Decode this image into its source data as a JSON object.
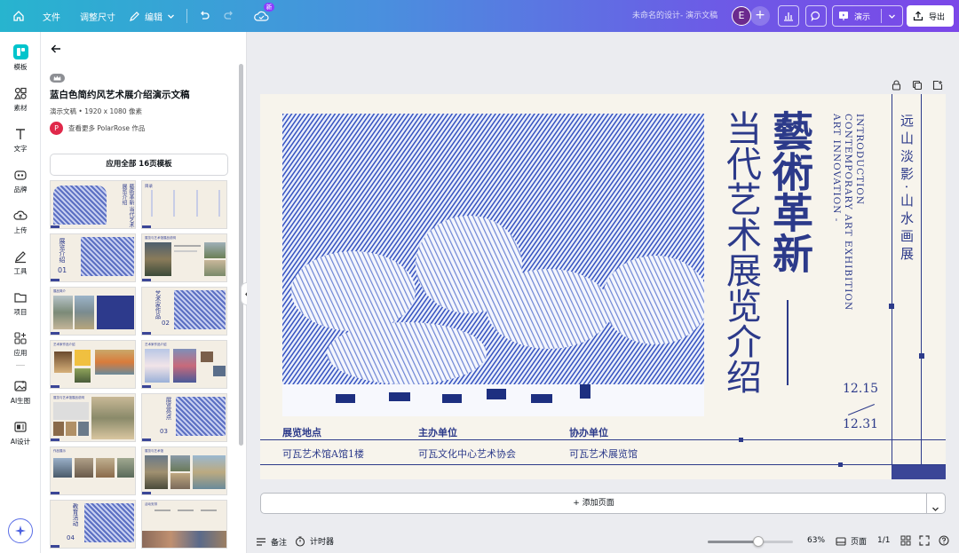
{
  "topbar": {
    "file": "文件",
    "resize": "调整尺寸",
    "edit": "编辑",
    "new_badge": "新",
    "design_title": "未命名的设计- 演示文稿",
    "avatar_letter": "E",
    "present": "演示",
    "export": "导出"
  },
  "rail": {
    "items": [
      {
        "label": "模板",
        "icon": "template-icon"
      },
      {
        "label": "素材",
        "icon": "elements-icon"
      },
      {
        "label": "文字",
        "icon": "text-icon"
      },
      {
        "label": "品牌",
        "icon": "brand-icon"
      },
      {
        "label": "上传",
        "icon": "upload-icon"
      },
      {
        "label": "工具",
        "icon": "draw-icon"
      },
      {
        "label": "项目",
        "icon": "folder-icon"
      },
      {
        "label": "应用",
        "icon": "apps-icon"
      },
      {
        "label": "AI生图",
        "icon": "ai-image-icon"
      },
      {
        "label": "AI设计",
        "icon": "ai-design-icon"
      }
    ]
  },
  "panel": {
    "title": "蓝白色简约风艺术展介绍演示文稿",
    "meta": "演示文稿 • 1920 x 1080 像素",
    "author_letter": "P",
    "author": "查看更多 PolarRose 作品",
    "apply_all": "应用全部 16页模板",
    "thumbs": [
      {
        "label": "藝術革新 当代艺术展览介绍"
      },
      {
        "label": "目录"
      },
      {
        "label": "展览介绍",
        "num": "01"
      },
      {
        "label": "展览与艺术馆展品说明"
      },
      {
        "label": "展品简介"
      },
      {
        "label": "艺术家作品",
        "num": "02"
      },
      {
        "label": "艺术家作品介绍"
      },
      {
        "label": "艺术家作品介绍"
      },
      {
        "label": "展览与艺术馆展品说明"
      },
      {
        "label": "展览亮点",
        "num": "03"
      },
      {
        "label": "作品展示"
      },
      {
        "label": "展览与艺术馆"
      },
      {
        "label": "教育活动",
        "num": "04"
      },
      {
        "label": "活动安排"
      }
    ]
  },
  "slide": {
    "title_main": "藝術革新",
    "title_sub": "当代艺术展览介绍",
    "english_1": "ART INNOVATION -",
    "english_2": "CONTEMPORARY ART EXHIBITION",
    "english_3": "INTRODUCTION",
    "side_title": "远山淡影·山水画展",
    "date_start": "12.15",
    "date_end": "12.31",
    "info": [
      {
        "heading": "展览地点",
        "value": "可瓦艺术馆A馆1楼"
      },
      {
        "heading": "主办单位",
        "value": "可瓦文化中心艺术协会"
      },
      {
        "heading": "协办单位",
        "value": "可瓦艺术展览馆"
      }
    ]
  },
  "canvas": {
    "add_page": "+ 添加页面"
  },
  "bottombar": {
    "notes": "备注",
    "timer": "计时器",
    "zoom_percent": "63%",
    "zoom_level": 0.63,
    "pages_label": "页面",
    "page_count": "1/1"
  },
  "colors": {
    "accent": "#3b4697",
    "slide_bg": "#f7f4ec"
  }
}
